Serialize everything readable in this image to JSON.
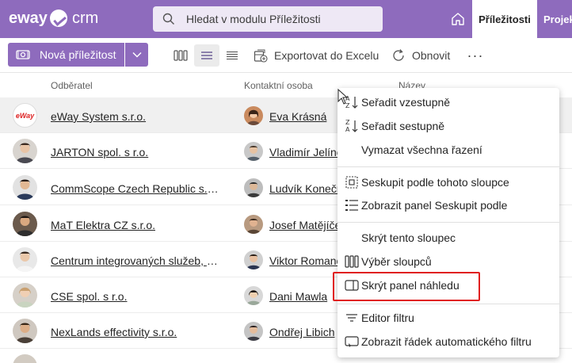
{
  "app": {
    "logo_left": "eway",
    "logo_right": "crm"
  },
  "search": {
    "placeholder": "Hledat v modulu Příležitosti"
  },
  "nav": {
    "active_tab": "Příležitosti",
    "next_tab": "Projek"
  },
  "toolbar": {
    "new_label": "Nová příležitost",
    "export_label": "Exportovat do Excelu",
    "refresh_label": "Obnovit",
    "more_label": "···"
  },
  "grid": {
    "columns": [
      "Odběratel",
      "Kontaktní osoba",
      "Název"
    ],
    "rows": [
      {
        "company": "eWay System s.r.o.",
        "person": "Eva Krásná",
        "logo_text": "eWay"
      },
      {
        "company": "JARTON spol. s r.o.",
        "person": "Vladimír Jelínek"
      },
      {
        "company": "CommScope Czech Republic s.r.o.",
        "person": "Ludvík Konečný"
      },
      {
        "company": "MaT Elektra CZ s.r.o.",
        "person": "Josef Matějíček"
      },
      {
        "company": "Centrum integrovaných služeb, s.r.o.",
        "person": "Viktor Romanov"
      },
      {
        "company": "CSE spol. s r.o.",
        "person": "Dani Mawla"
      },
      {
        "company": "NexLands effectivity s.r.o.",
        "person": "Ondřej Libich"
      }
    ]
  },
  "context_menu": {
    "items": [
      {
        "label": "Seřadit vzestupně",
        "icon": "sort-ascending-icon"
      },
      {
        "label": "Seřadit sestupně",
        "icon": "sort-descending-icon"
      },
      {
        "label": "Vymazat všechna řazení",
        "icon": ""
      },
      {
        "label": "Seskupit podle tohoto sloupce",
        "icon": "group-by-column-icon"
      },
      {
        "label": "Zobrazit panel Seskupit podle",
        "icon": "group-panel-icon"
      },
      {
        "label": "Skrýt tento sloupec",
        "icon": ""
      },
      {
        "label": "Výběr sloupců",
        "icon": "column-chooser-icon"
      },
      {
        "label": "Skrýt panel náhledu",
        "icon": "preview-panel-icon"
      },
      {
        "label": "Editor filtru",
        "icon": "filter-editor-icon"
      },
      {
        "label": "Zobrazit řádek automatického filtru",
        "icon": "auto-filter-row-icon"
      }
    ]
  },
  "colors": {
    "brand": "#8e6bbd",
    "highlight_border": "#e02020"
  }
}
